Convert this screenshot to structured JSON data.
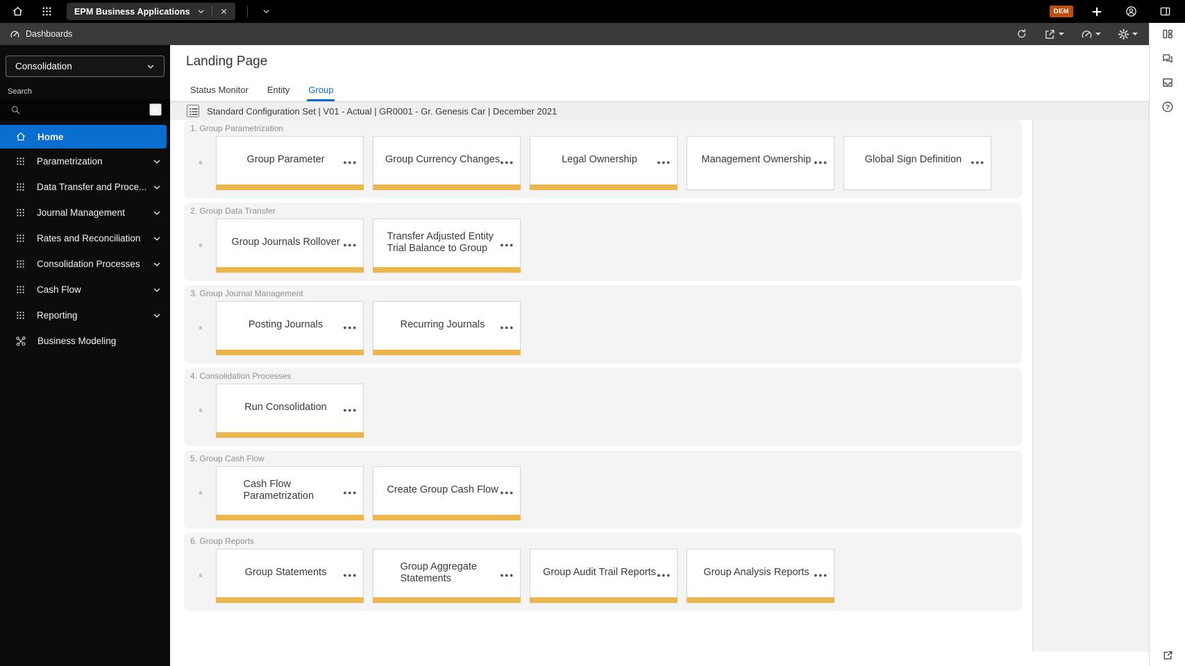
{
  "header": {
    "app_tab_label": "EPM Business Applications",
    "env_badge": "DEM",
    "icons": [
      "home-icon",
      "app-switcher-icon",
      "chevron-down-icon",
      "close-icon",
      "add-icon",
      "account-icon",
      "side-panel-icon"
    ]
  },
  "toolbar": {
    "breadcrumb": "Dashboards",
    "icons": [
      "dashboard-gauge-icon",
      "refresh-icon",
      "share-icon",
      "jump-to-icon",
      "settings-gear-icon"
    ]
  },
  "rail": {
    "icons": [
      "layout-panel-icon",
      "comments-icon",
      "inbox-icon",
      "help-icon",
      "open-external-icon"
    ]
  },
  "sidebar": {
    "context_selector": "Consolidation",
    "search_label": "Search",
    "colors": {
      "active_item": "#0a6ed1"
    },
    "items": [
      {
        "label": "Home",
        "icon": "home-icon",
        "active": true,
        "chevron": false
      },
      {
        "label": "Parametrization",
        "icon": "grid-icon",
        "active": false,
        "chevron": true
      },
      {
        "label": "Data Transfer and Proce...",
        "icon": "grid-icon",
        "active": false,
        "chevron": true
      },
      {
        "label": "Journal Management",
        "icon": "grid-icon",
        "active": false,
        "chevron": true
      },
      {
        "label": "Rates and Reconciliation",
        "icon": "grid-icon",
        "active": false,
        "chevron": true
      },
      {
        "label": "Consolidation Processes",
        "icon": "grid-icon",
        "active": false,
        "chevron": true
      },
      {
        "label": "Cash Flow",
        "icon": "grid-icon",
        "active": false,
        "chevron": true
      },
      {
        "label": "Reporting",
        "icon": "grid-icon",
        "active": false,
        "chevron": true
      },
      {
        "label": "Business Modeling",
        "icon": "network-icon",
        "active": false,
        "chevron": false
      }
    ]
  },
  "main": {
    "title": "Landing Page",
    "tabs": [
      {
        "label": "Status Monitor",
        "active": false
      },
      {
        "label": "Entity",
        "active": false
      },
      {
        "label": "Group",
        "active": true
      }
    ],
    "context_bar": "Standard Configuration Set | V01 - Actual | GR0001 - Gr. Genesis Car | December 2021",
    "colors": {
      "tile_bar": "#edb64c",
      "accent": "#0a6ed1"
    },
    "sections": [
      {
        "label": "1. Group Parametrization",
        "cards": [
          {
            "title": "Group Parameter",
            "bar": true
          },
          {
            "title": "Group Currency Changes",
            "bar": true
          },
          {
            "title": "Legal Ownership",
            "bar": true
          },
          {
            "title": "Management Ownership",
            "bar": false
          },
          {
            "title": "Global Sign Definition",
            "bar": false
          }
        ]
      },
      {
        "label": "2. Group Data Transfer",
        "cards": [
          {
            "title": "Group Journals Rollover",
            "bar": true
          },
          {
            "title": "Transfer Adjusted Entity Trial Balance to Group",
            "bar": true
          }
        ]
      },
      {
        "label": "3. Group Journal Management",
        "cards": [
          {
            "title": "Posting Journals",
            "bar": true
          },
          {
            "title": "Recurring Journals",
            "bar": true
          }
        ]
      },
      {
        "label": "4. Consolidation Processes",
        "cards": [
          {
            "title": "Run Consolidation",
            "bar": true
          }
        ]
      },
      {
        "label": "5. Group Cash Flow",
        "cards": [
          {
            "title": "Cash Flow Parametrization",
            "bar": true
          },
          {
            "title": "Create Group Cash Flow",
            "bar": true
          }
        ]
      },
      {
        "label": "6. Group Reports",
        "cards": [
          {
            "title": "Group Statements",
            "bar": true
          },
          {
            "title": "Group Aggregate Statements",
            "bar": true
          },
          {
            "title": "Group Audit Trail Reports",
            "bar": true
          },
          {
            "title": "Group Analysis Reports",
            "bar": true
          }
        ]
      }
    ]
  }
}
